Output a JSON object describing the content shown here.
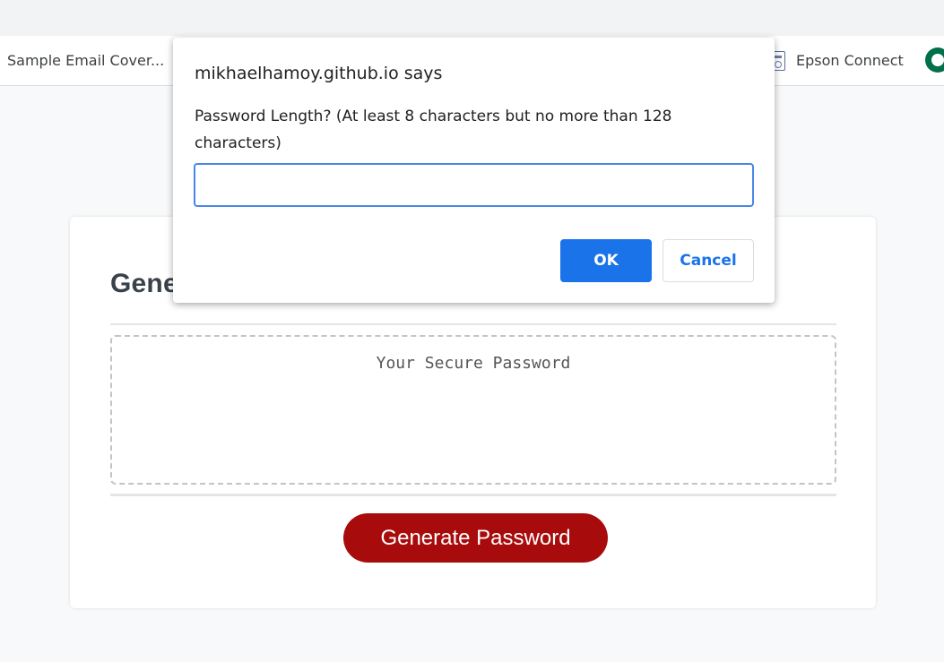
{
  "bookmarks": {
    "sample_email": "Sample Email Cover...",
    "epson_icon": "epson-app-icon",
    "epson": "Epson Connect",
    "starbucks_icon": "starbucks-logo-icon"
  },
  "page": {
    "title": "Gene",
    "password_placeholder": "Your Secure Password",
    "generate_label": "Generate Password"
  },
  "dialog": {
    "origin": "mikhaelhamoy.github.io says",
    "message": "Password Length? (At least 8 characters but no more than 128 characters)",
    "input_value": "",
    "ok_label": "OK",
    "cancel_label": "Cancel"
  },
  "colors": {
    "generate_button": "#a80b0b",
    "ok_button": "#1a73e8",
    "input_focus": "#4a86e8",
    "starbucks_green": "#00704a"
  }
}
